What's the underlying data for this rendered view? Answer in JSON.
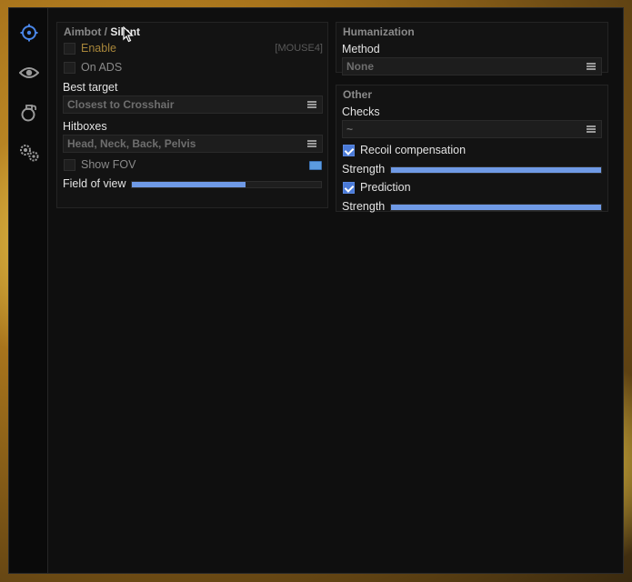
{
  "sidebar": {
    "items": [
      {
        "icon": "crosshair-icon",
        "active": true
      },
      {
        "icon": "eye-icon",
        "active": false
      },
      {
        "icon": "grenade-icon",
        "active": false
      },
      {
        "icon": "gears-icon",
        "active": false
      }
    ]
  },
  "aimbot": {
    "title": "Aimbot",
    "separator": " / ",
    "subtitle": "Silent",
    "enable_label": "Enable",
    "enable_checked": false,
    "enable_key": "[MOUSE4]",
    "on_ads_label": "On ADS",
    "on_ads_checked": false,
    "best_target_label": "Best target",
    "best_target_value": "Closest to Crosshair",
    "hitboxes_label": "Hitboxes",
    "hitboxes_value": "Head, Neck, Back, Pelvis",
    "show_fov_label": "Show FOV",
    "show_fov_checked": false,
    "fov_color": "#5b9be0",
    "field_of_view_label": "Field of view",
    "field_of_view_fraction": 0.6
  },
  "humanization": {
    "title": "Humanization",
    "method_label": "Method",
    "method_value": "None"
  },
  "other": {
    "title": "Other",
    "checks_label": "Checks",
    "checks_value": "~",
    "recoil_label": "Recoil compensation",
    "recoil_checked": true,
    "recoil_strength_label": "Strength",
    "recoil_strength_fraction": 1.0,
    "prediction_label": "Prediction",
    "prediction_checked": true,
    "prediction_strength_label": "Strength",
    "prediction_strength_fraction": 1.0
  },
  "colors": {
    "accent": "#4a7ad8",
    "slider_fill": "#6f9ae6",
    "enable_text": "#a8863a"
  }
}
